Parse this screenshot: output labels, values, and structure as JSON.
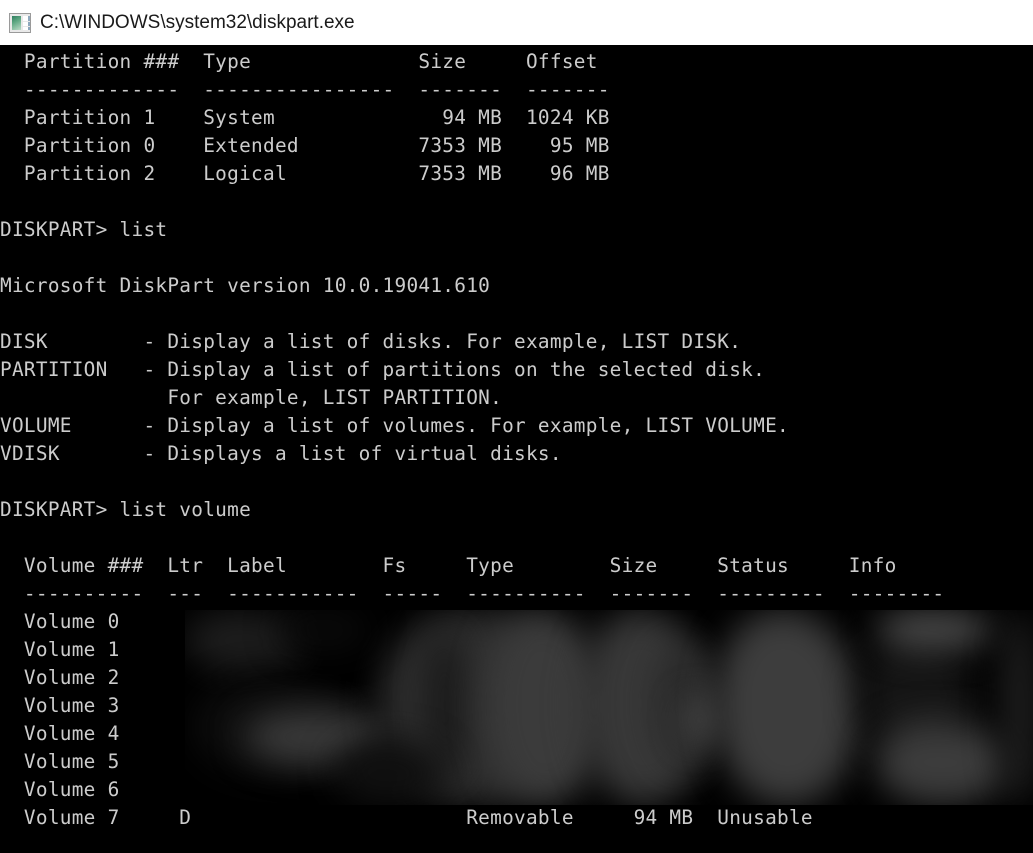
{
  "window": {
    "title": "C:\\WINDOWS\\system32\\diskpart.exe",
    "icon": "console-window-icon",
    "titlebar_bg": "#ffffff",
    "titlebar_fg": "#1a1a1a"
  },
  "console": {
    "bg": "#000000",
    "fg": "#cccccc",
    "font_size_px": 19.4,
    "line_height_px": 28,
    "lines": [
      "  Partition ###  Type              Size     Offset",
      "  -------------  ----------------  -------  -------",
      "  Partition 1    System              94 MB  1024 KB",
      "  Partition 0    Extended          7353 MB    95 MB",
      "  Partition 2    Logical           7353 MB    96 MB",
      "",
      "DISKPART> list",
      "",
      "Microsoft DiskPart version 10.0.19041.610",
      "",
      "DISK        - Display a list of disks. For example, LIST DISK.",
      "PARTITION   - Display a list of partitions on the selected disk.",
      "              For example, LIST PARTITION.",
      "VOLUME      - Display a list of volumes. For example, LIST VOLUME.",
      "VDISK       - Displays a list of virtual disks.",
      "",
      "DISKPART> list volume",
      "",
      "  Volume ###  Ltr  Label        Fs     Type        Size     Status     Info",
      "  ----------  ---  -----------  -----  ----------  -------  ---------  --------",
      "  Volume 0",
      "  Volume 1",
      "  Volume 2",
      "  Volume 3",
      "  Volume 4",
      "  Volume 5",
      "  Volume 6",
      "  Volume 7     D                       Removable     94 MB  Unusable"
    ]
  },
  "partition_table": {
    "headers": [
      "Partition ###",
      "Type",
      "Size",
      "Offset"
    ],
    "rows": [
      {
        "partition": "Partition 1",
        "type": "System",
        "size": "94 MB",
        "offset": "1024 KB"
      },
      {
        "partition": "Partition 0",
        "type": "Extended",
        "size": "7353 MB",
        "offset": "95 MB"
      },
      {
        "partition": "Partition 2",
        "type": "Logical",
        "size": "7353 MB",
        "offset": "96 MB"
      }
    ]
  },
  "commands": [
    {
      "prompt": "DISKPART>",
      "command": "list"
    },
    {
      "prompt": "DISKPART>",
      "command": "list volume"
    }
  ],
  "version_line": "Microsoft DiskPart version 10.0.19041.610",
  "help": {
    "entries": [
      {
        "keyword": "DISK",
        "dash": "-",
        "description": "Display a list of disks. For example, LIST DISK."
      },
      {
        "keyword": "PARTITION",
        "dash": "-",
        "description": "Display a list of partitions on the selected disk."
      },
      {
        "keyword": "",
        "dash": "",
        "description": "For example, LIST PARTITION."
      },
      {
        "keyword": "VOLUME",
        "dash": "-",
        "description": "Display a list of volumes. For example, LIST VOLUME."
      },
      {
        "keyword": "VDISK",
        "dash": "-",
        "description": "Displays a list of virtual disks."
      }
    ]
  },
  "volume_table": {
    "headers": [
      "Volume ###",
      "Ltr",
      "Label",
      "Fs",
      "Type",
      "Size",
      "Status",
      "Info"
    ],
    "rows": [
      {
        "volume": "Volume 0",
        "ltr": "",
        "label": "",
        "fs": "",
        "type": "",
        "size": "",
        "status": "",
        "info": "",
        "redacted": true
      },
      {
        "volume": "Volume 1",
        "ltr": "",
        "label": "",
        "fs": "",
        "type": "",
        "size": "",
        "status": "",
        "info": "",
        "redacted": true
      },
      {
        "volume": "Volume 2",
        "ltr": "",
        "label": "",
        "fs": "",
        "type": "",
        "size": "",
        "status": "",
        "info": "",
        "redacted": true
      },
      {
        "volume": "Volume 3",
        "ltr": "",
        "label": "",
        "fs": "",
        "type": "",
        "size": "",
        "status": "",
        "info": "",
        "redacted": true
      },
      {
        "volume": "Volume 4",
        "ltr": "",
        "label": "",
        "fs": "",
        "type": "",
        "size": "",
        "status": "",
        "info": "",
        "redacted": true
      },
      {
        "volume": "Volume 5",
        "ltr": "",
        "label": "",
        "fs": "",
        "type": "",
        "size": "",
        "status": "",
        "info": "",
        "redacted": true
      },
      {
        "volume": "Volume 6",
        "ltr": "",
        "label": "",
        "fs": "",
        "type": "",
        "size": "",
        "status": "",
        "info": "",
        "redacted": true
      },
      {
        "volume": "Volume 7",
        "ltr": "D",
        "label": "",
        "fs": "",
        "type": "Removable",
        "size": "94 MB",
        "status": "Unusable",
        "info": "",
        "redacted": false
      }
    ],
    "redaction_note": "blurred region covering Ltr through Info columns for volumes 0-6"
  }
}
